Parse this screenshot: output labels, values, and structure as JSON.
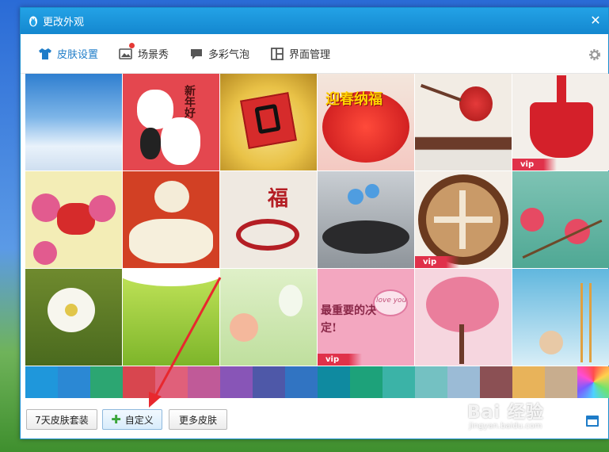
{
  "window": {
    "title": "更改外观"
  },
  "tabs": [
    {
      "label": "皮肤设置",
      "icon": "shirt-icon"
    },
    {
      "label": "场景秀",
      "icon": "picture-icon"
    },
    {
      "label": "多彩气泡",
      "icon": "bubble-icon"
    },
    {
      "label": "界面管理",
      "icon": "layout-icon"
    }
  ],
  "tiles": [
    {
      "name": "sky-clouds",
      "text": ""
    },
    {
      "name": "new-year-bears",
      "text": "新年好"
    },
    {
      "name": "fu-card",
      "text": ""
    },
    {
      "name": "lantern-greeting",
      "text": "迎春纳福"
    },
    {
      "name": "plum-lantern",
      "text": ""
    },
    {
      "name": "red-knot",
      "text": "",
      "vip": "vip"
    },
    {
      "name": "paper-cut-goat",
      "text": ""
    },
    {
      "name": "sheep-flock",
      "text": ""
    },
    {
      "name": "fu-papercut",
      "text": "福"
    },
    {
      "name": "stone-flower",
      "text": ""
    },
    {
      "name": "latte-snowflake",
      "text": "",
      "vip": "vip"
    },
    {
      "name": "pink-blossom",
      "text": ""
    },
    {
      "name": "white-blossom",
      "text": ""
    },
    {
      "name": "green-meadow",
      "text": ""
    },
    {
      "name": "green-butterfly",
      "text": ""
    },
    {
      "name": "love-decision",
      "text": "最重要的决定!",
      "badge": "love you",
      "vip": "vip"
    },
    {
      "name": "pink-tree",
      "text": ""
    },
    {
      "name": "winter-ladder",
      "text": ""
    }
  ],
  "swatch_colors": [
    "#1f97db",
    "#2b88d4",
    "#2ca672",
    "#d8464f",
    "#e0607a",
    "#c05a98",
    "#8855b7",
    "#4e58a8",
    "#3174c2",
    "#0f8aa0",
    "#1da27a",
    "#3bb3a7",
    "#74c1c2",
    "#9bbbd6",
    "#8b5054",
    "#e8b35a",
    "#c8ad8e",
    "#rainbow"
  ],
  "buttons": {
    "seven_day": "7天皮肤套装",
    "custom": "自定义",
    "more": "更多皮肤"
  },
  "watermark": {
    "main": "Bai 经验",
    "sub": "jingyan.baidu.com"
  }
}
